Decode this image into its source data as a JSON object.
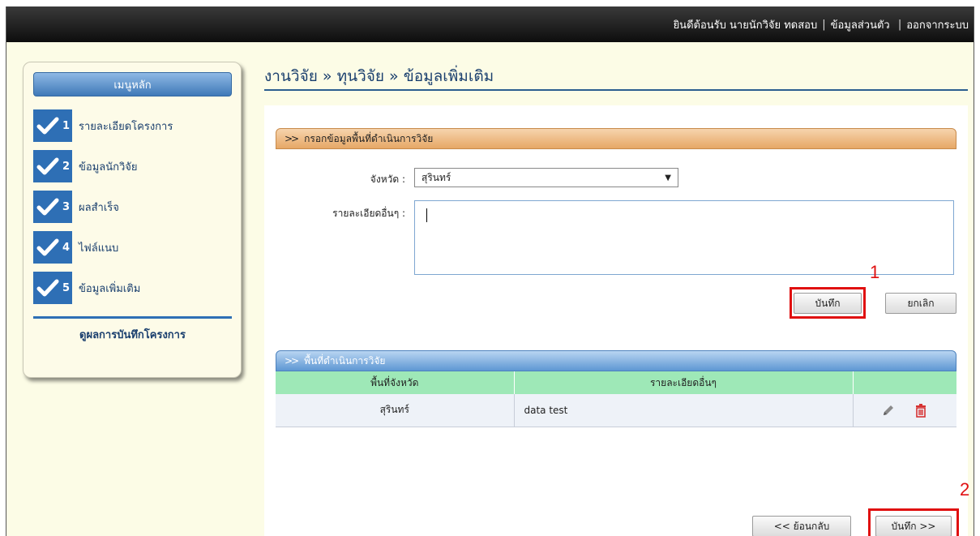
{
  "topbar": {
    "welcome": "ยินดีต้อนรับ นายนักวิจัย ทดสอบ",
    "profile": "ข้อมูลส่วนตัว",
    "logout": "ออกจากระบบ"
  },
  "sidebar": {
    "title": "เมนูหลัก",
    "items": [
      {
        "num": "1",
        "label": "รายละเอียดโครงการ"
      },
      {
        "num": "2",
        "label": "ข้อมูลนักวิจัย"
      },
      {
        "num": "3",
        "label": "ผลสำเร็จ"
      },
      {
        "num": "4",
        "label": "ไฟล์แนบ"
      },
      {
        "num": "5",
        "label": "ข้อมูลเพิ่มเติม"
      }
    ],
    "view_link": "ดูผลการบันทึกโครงการ"
  },
  "breadcrumb": "งานวิจัย » ทุนวิจัย » ข้อมูลเพิ่มเติม",
  "form": {
    "header": "กรอกข้อมูลพื้นที่ดำเนินการวิจัย",
    "province_label": "จังหวัด :",
    "province_value": "สุรินทร์",
    "details_label": "รายละเอียดอื่นๆ :",
    "details_value": "",
    "save_label": "บันทึก",
    "cancel_label": "ยกเลิก"
  },
  "table": {
    "header": "พื้นที่ดำเนินการวิจัย",
    "columns": [
      "พื้นที่จังหวัด",
      "รายละเอียดอื่นๆ",
      ""
    ],
    "rows": [
      {
        "province": "สุรินทร์",
        "details": "data test"
      }
    ]
  },
  "footer": {
    "back_label": "<< ย้อนกลับ",
    "save_next_label": "บันทึก >>"
  },
  "annotations": {
    "one": "1",
    "two": "2"
  },
  "colors": {
    "accent_blue": "#2e6fb5",
    "form_header": "#e6a766",
    "table_header": "#5e97d3",
    "table_col_header": "#9ee8b7",
    "highlight_red": "#e01010"
  }
}
